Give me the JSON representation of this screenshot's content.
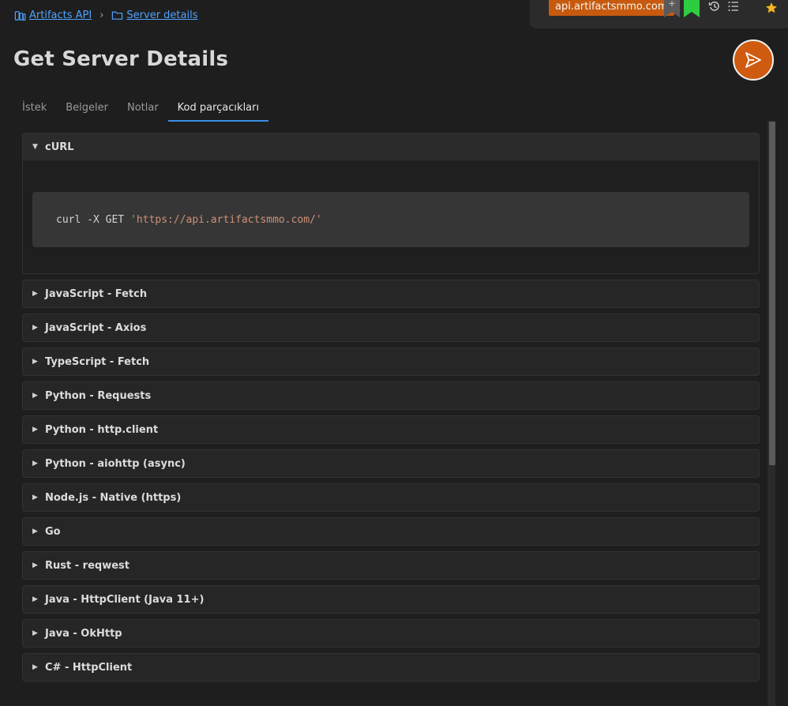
{
  "breadcrumb": {
    "root": "Artifacts API",
    "current": "Server details"
  },
  "topbar": {
    "host": "api.artifactsmmo.com",
    "accent_color": "#c75a0e",
    "bookmark_gray_color": "#5a5a5a",
    "bookmark_green_color": "#2ecc40"
  },
  "title": "Get Server Details",
  "tabs": [
    {
      "label": "İstek",
      "active": false
    },
    {
      "label": "Belgeler",
      "active": false
    },
    {
      "label": "Notlar",
      "active": false
    },
    {
      "label": "Kod parçacıkları",
      "active": true
    }
  ],
  "snippets": {
    "open": {
      "label": "cURL",
      "code_cmd": "curl -X GET",
      "code_url": "'https://api.artifactsmmo.com/'"
    },
    "collapsed": [
      "JavaScript - Fetch",
      "JavaScript - Axios",
      "TypeScript - Fetch",
      "Python - Requests",
      "Python - http.client",
      "Python - aiohttp (async)",
      "Node.js - Native (https)",
      "Go",
      "Rust - reqwest",
      "Java - HttpClient (Java 11+)",
      "Java - OkHttp",
      "C# - HttpClient"
    ]
  }
}
